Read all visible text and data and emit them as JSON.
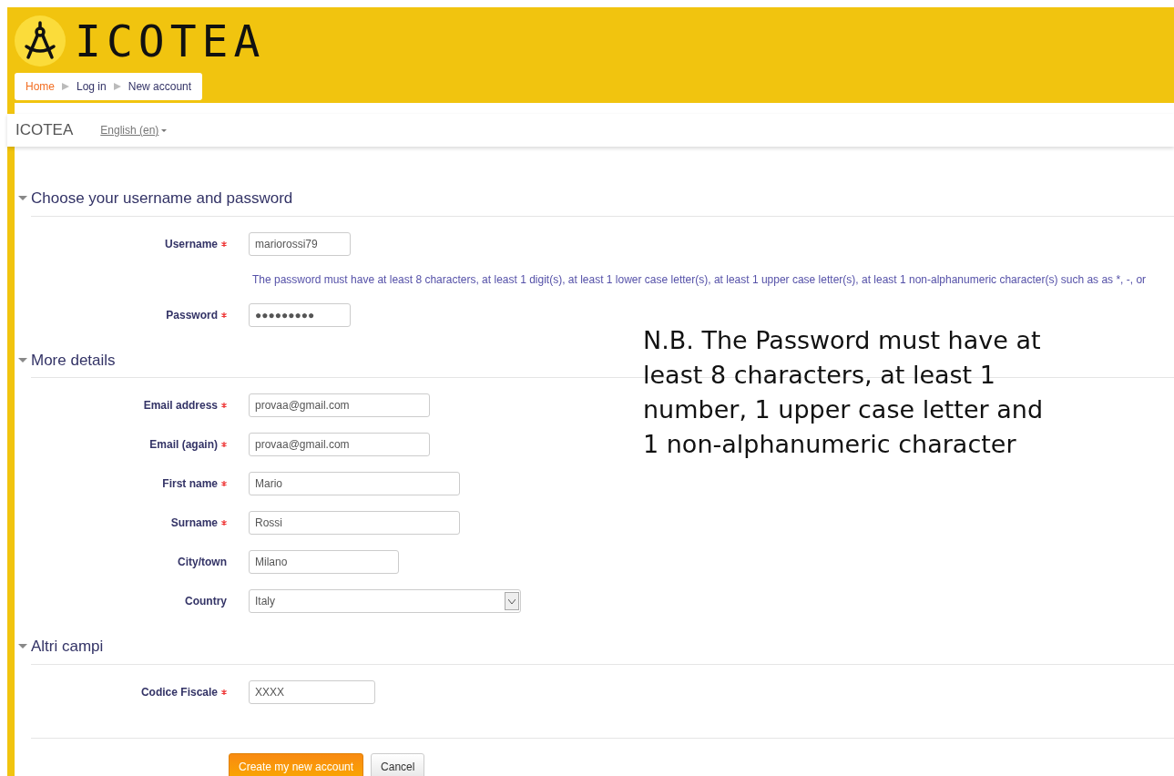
{
  "header": {
    "logo_text": "ICOTEA",
    "breadcrumb": [
      {
        "label": "Home",
        "kind": "link"
      },
      {
        "label": "Log in",
        "kind": "current"
      },
      {
        "label": "New account",
        "kind": "current"
      }
    ]
  },
  "navbar": {
    "brand": "ICOTEA",
    "language": "English (en)"
  },
  "sections": [
    {
      "title": "Choose your username and password",
      "expanded": true,
      "fields": [
        {
          "kind": "input",
          "label": "Username",
          "required": true,
          "value": "mariorossi79"
        },
        {
          "kind": "note",
          "text": "The password must have at least 8 characters, at least 1 digit(s), at least 1 lower case letter(s), at least 1 upper case letter(s), at least 1 non-alphanumeric character(s) such as as *, -, or"
        },
        {
          "kind": "input",
          "label": "Password",
          "required": true,
          "value": "●●●●●●●●●"
        }
      ]
    },
    {
      "title": "More details",
      "expanded": true,
      "fields": [
        {
          "kind": "input",
          "label": "Email address",
          "required": true,
          "value": "provaa@gmail.com"
        },
        {
          "kind": "input",
          "label": "Email (again)",
          "required": true,
          "value": "provaa@gmail.com"
        },
        {
          "kind": "input",
          "label": "First name",
          "required": true,
          "value": "Mario"
        },
        {
          "kind": "input",
          "label": "Surname",
          "required": true,
          "value": "Rossi"
        },
        {
          "kind": "input",
          "label": "City/town",
          "required": false,
          "value": "Milano"
        },
        {
          "kind": "select",
          "label": "Country",
          "required": false,
          "value": "Italy"
        }
      ]
    },
    {
      "title": "Altri campi",
      "expanded": true,
      "fields": [
        {
          "kind": "input",
          "label": "Codice Fiscale",
          "required": true,
          "value": "XXXX"
        }
      ]
    }
  ],
  "buttons": [
    {
      "label": "Create my new account",
      "kind": "primary"
    },
    {
      "label": "Cancel",
      "kind": "secondary"
    }
  ],
  "annotation": "N.B. The Password must have at least 8 characters, at least 1 number, 1 upper case letter and 1 non-alphanumeric character"
}
